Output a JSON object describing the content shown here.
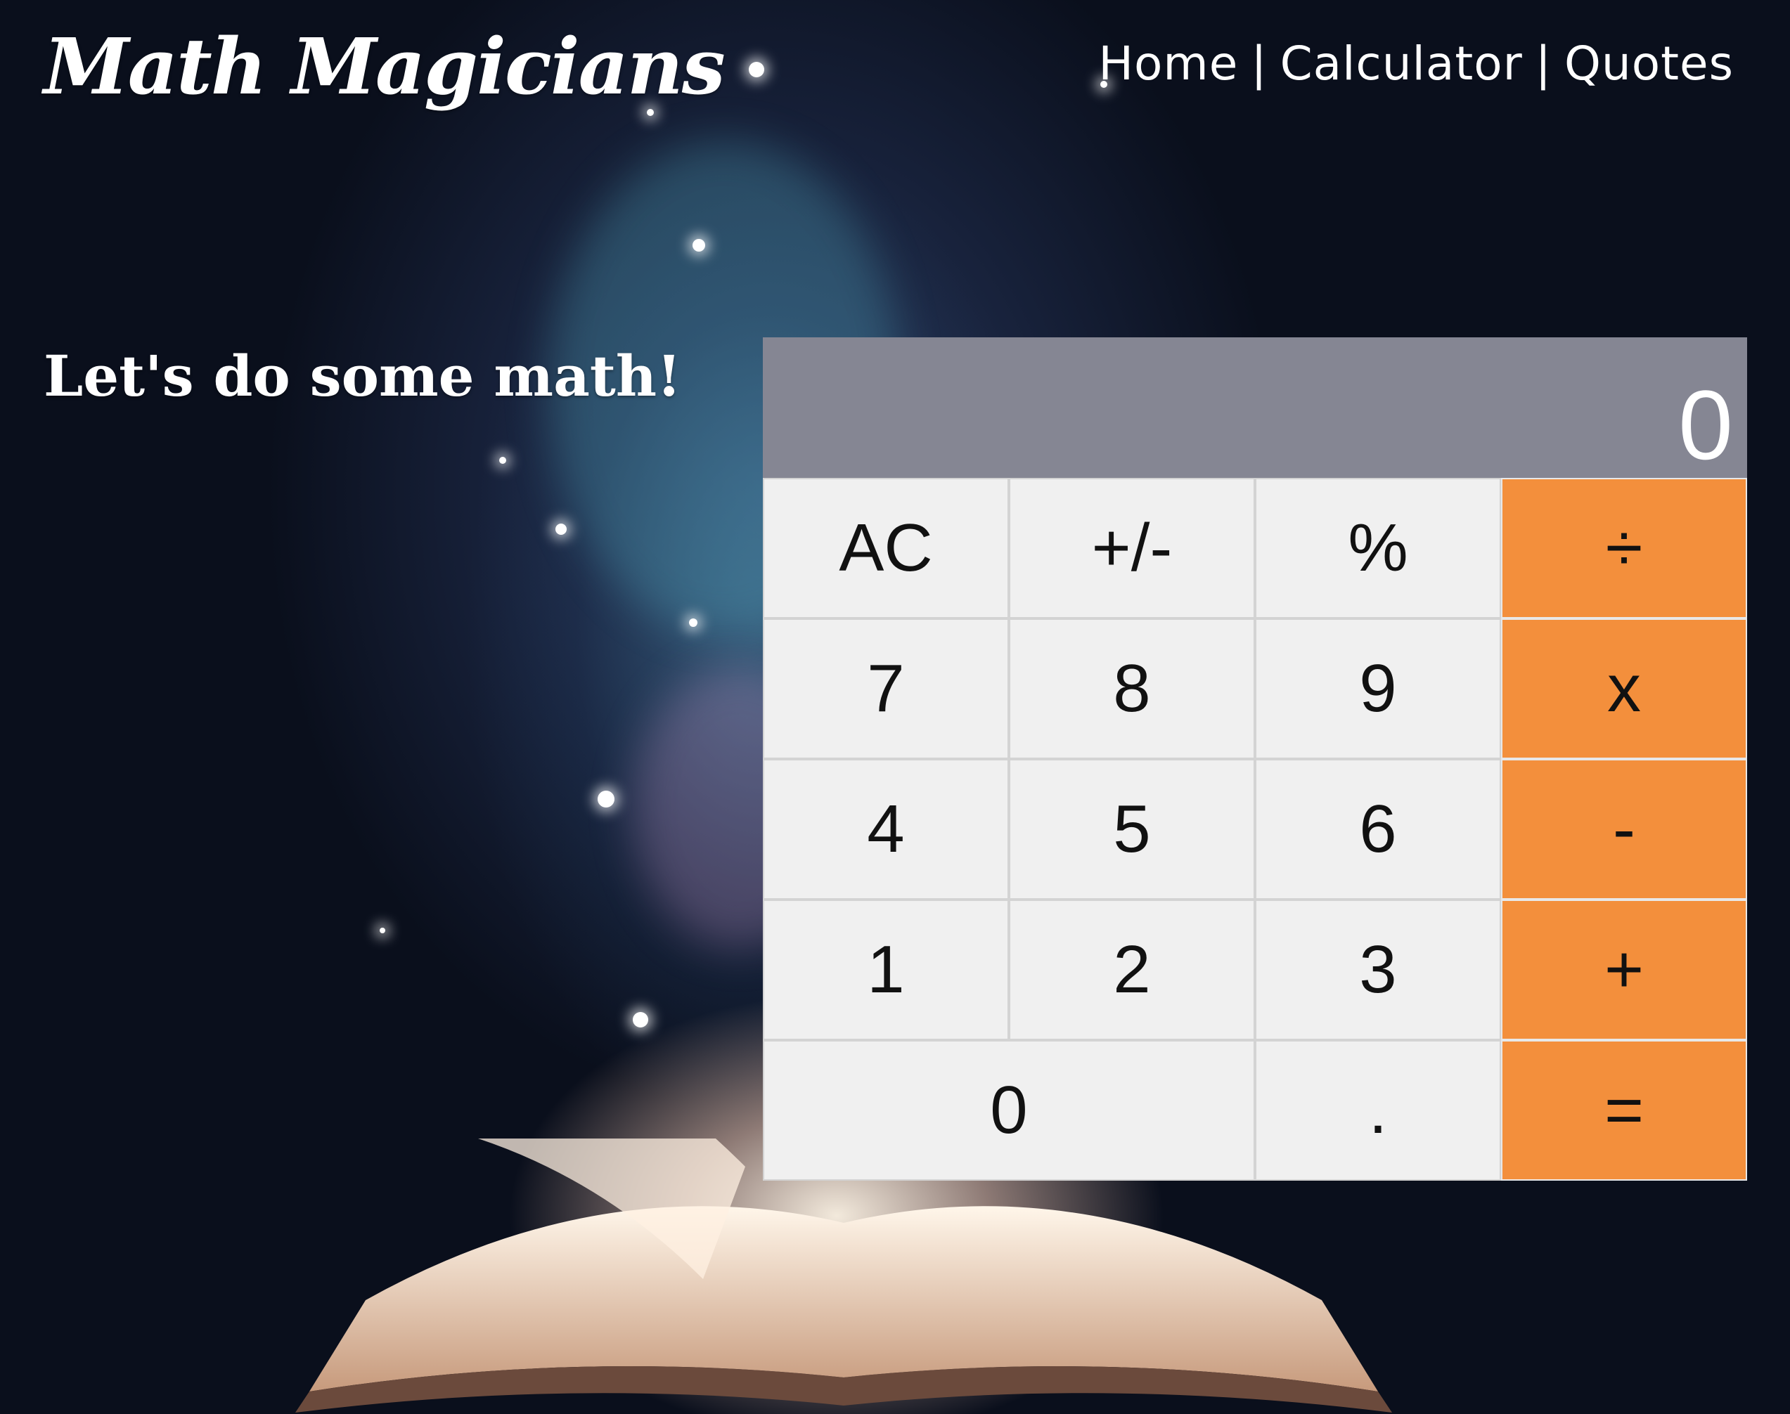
{
  "header": {
    "brand": "Math Magicians",
    "nav": [
      {
        "label": "Home"
      },
      {
        "label": "Calculator"
      },
      {
        "label": "Quotes"
      }
    ],
    "separator": "|"
  },
  "main": {
    "tagline": "Let's do some math!"
  },
  "calculator": {
    "display": "0",
    "keys": {
      "clear": "AC",
      "sign": "+/-",
      "percent": "%",
      "divide": "÷",
      "seven": "7",
      "eight": "8",
      "nine": "9",
      "multiply": "x",
      "four": "4",
      "five": "5",
      "six": "6",
      "subtract": "-",
      "one": "1",
      "two": "2",
      "three": "3",
      "add": "+",
      "zero": "0",
      "decimal": ".",
      "equals": "="
    }
  },
  "colors": {
    "display_bg": "#858693",
    "key_bg": "#f0f0f0",
    "operator_bg": "#f38f3c",
    "text_light": "#ffffff"
  }
}
